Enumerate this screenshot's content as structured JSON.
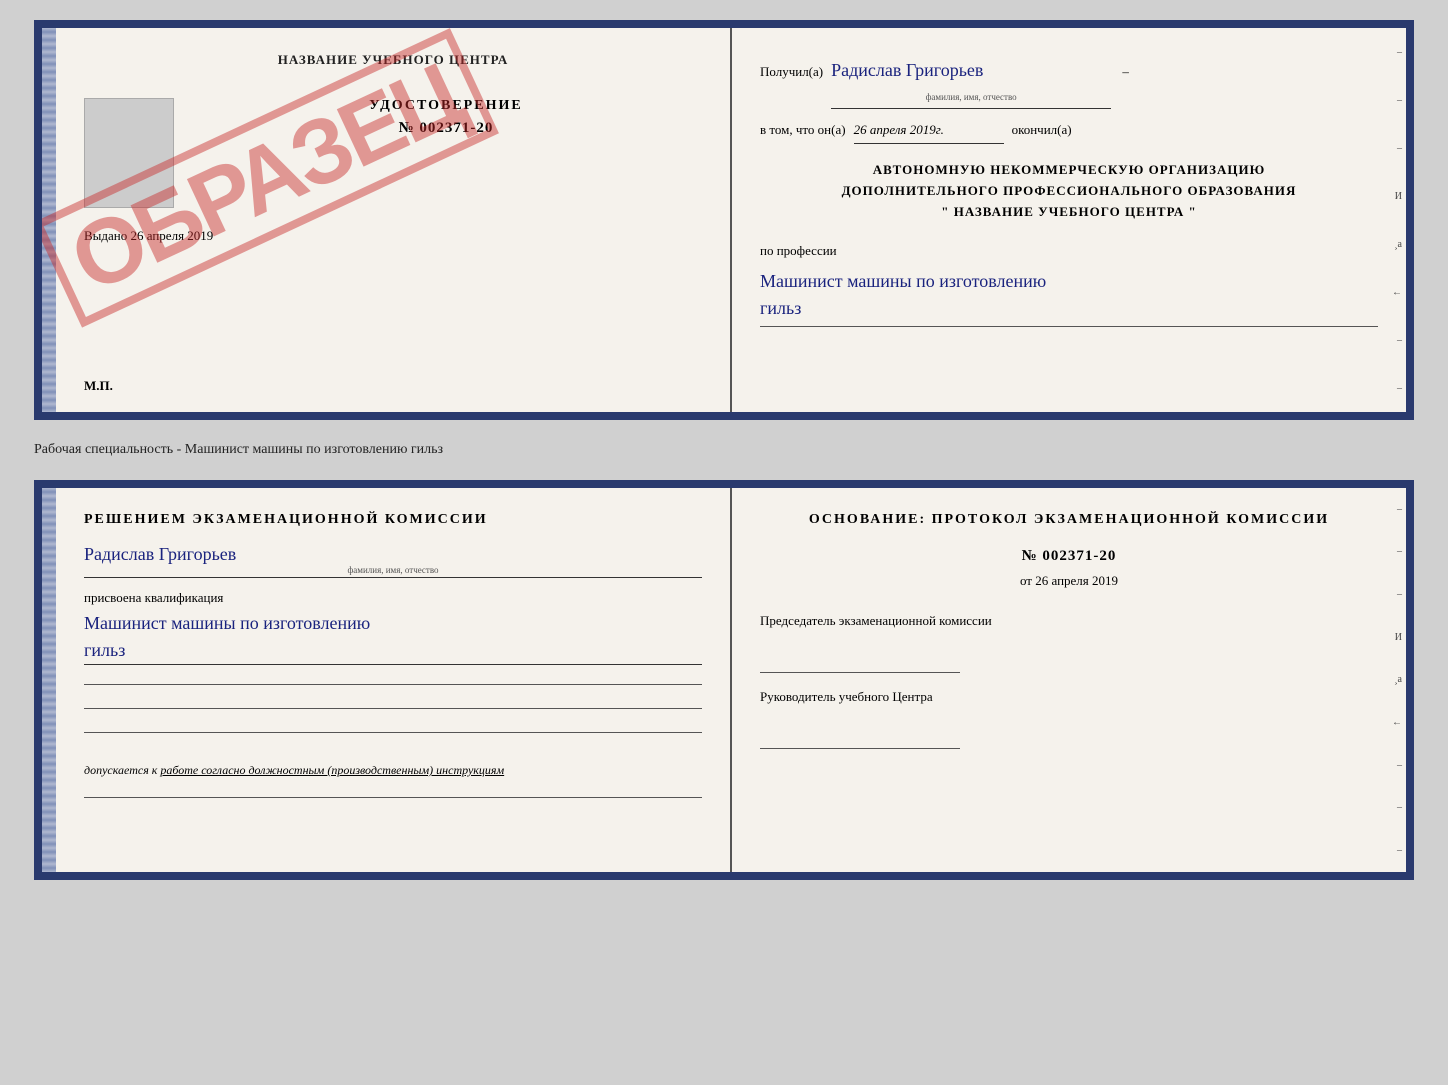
{
  "top_document": {
    "left": {
      "header": "НАЗВАНИЕ УЧЕБНОГО ЦЕНТРА",
      "cert_title": "УДОСТОВЕРЕНИЕ",
      "cert_number": "№ 002371-20",
      "issued_label": "Выдано",
      "issued_date": "26 апреля 2019",
      "stamp": "ОБРАЗЕЦ",
      "mp_label": "М.П."
    },
    "right": {
      "received_label": "Получил(а)",
      "recipient_name": "Радислав Григорьев",
      "recipient_sub": "фамилия, имя, отчество",
      "date_label": "в том, что он(а)",
      "date_value": "26 апреля 2019г.",
      "completed_label": "окончил(а)",
      "org_line1": "АВТОНОМНУЮ НЕКОММЕРЧЕСКУЮ ОРГАНИЗАЦИЮ",
      "org_line2": "ДОПОЛНИТЕЛЬНОГО ПРОФЕССИОНАЛЬНОГО ОБРАЗОВАНИЯ",
      "org_line3": "\" НАЗВАНИЕ УЧЕБНОГО ЦЕНТРА \"",
      "profession_label": "по профессии",
      "profession_value": "Машинист машины по изготовлению",
      "profession_value2": "гильз",
      "side_markers": [
        "–",
        "–",
        "И",
        "¸а",
        "←",
        "–",
        "–",
        "–"
      ]
    }
  },
  "separator": {
    "text": "Рабочая специальность - Машинист машины по изготовлению гильз"
  },
  "bottom_document": {
    "left": {
      "header": "Решением  экзаменационной  комиссии",
      "person_name": "Радислав Григорьев",
      "person_sub": "фамилия, имя, отчество",
      "qualification_label": "присвоена квалификация",
      "qualification_value": "Машинист машины по изготовлению",
      "qualification_value2": "гильз",
      "allow_label": "допускается к",
      "allow_value": "работе согласно должностным (производственным) инструкциям"
    },
    "right": {
      "basis_header": "Основание: протокол экзаменационной  комиссии",
      "basis_number": "№  002371-20",
      "basis_date_prefix": "от",
      "basis_date": "26 апреля 2019",
      "chairman_title": "Председатель экзаменационной комиссии",
      "center_head_title": "Руководитель учебного Центра",
      "side_markers": [
        "–",
        "–",
        "–",
        "И",
        "¸а",
        "←",
        "–",
        "–",
        "–"
      ]
    }
  }
}
